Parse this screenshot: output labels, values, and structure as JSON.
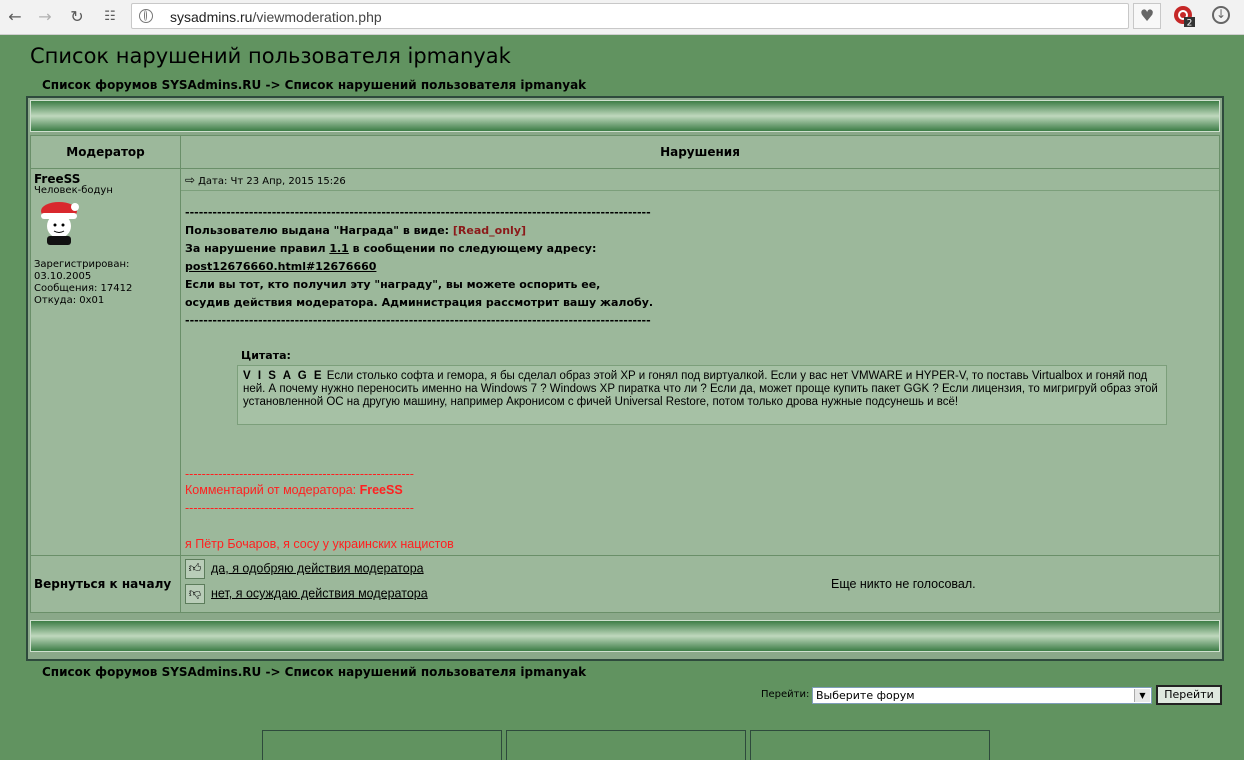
{
  "browser": {
    "url_host": "sysadmins.ru",
    "url_path": "/viewmoderation.php",
    "extension_badge": "2"
  },
  "page": {
    "title": "Список нарушений пользователя ipmanyak",
    "breadcrumb": {
      "root": "Список форумов SYSAdmins.RU",
      "sep": " -> ",
      "current": "Список нарушений пользователя ipmanyak"
    }
  },
  "table": {
    "col_moderator": "Модератор",
    "col_violations": "Нарушения"
  },
  "author": {
    "name": "FreeSS",
    "rank": "Человек-бодун",
    "registered_label": "Зарегистрирован:",
    "registered_date": "03.10.2005",
    "posts": "Сообщения: 17412",
    "from": "Откуда: 0x01"
  },
  "post": {
    "date": "Дата: Чт 23 Апр, 2015 15:26",
    "separator": "------------------------------------------------------------------------------------------------------",
    "award_prefix": "Пользователю выдана \"Награда\" в виде: ",
    "award_value": "[Read_only]",
    "rule_prefix": "За нарушение правил ",
    "rule_num": "1.1",
    "rule_suffix": " в сообщении по следующему адресу:",
    "link": "post12676660.html#12676660",
    "appeal_line1": "Если вы тот, кто получил эту \"награду\", вы можете оспорить ее,",
    "appeal_line2": "осудив действия модератора. Администрация рассмотрит вашу жалобу.",
    "quote_label": "Цитата:",
    "quote_author": "V I S A G E",
    "quote_text": "Если столько софта и гемора, я бы сделал образ этой XP и гонял под виртуалкой. Если у вас нет VMWARE и HYPER-V, то поставь Virtualbox и гоняй под ней. А почему нужно переносить именно на Windows 7 ? Windows XP пиратка что ли ? Если да, может проще купить пакет GGK ? Если лицензия, то мигригруй образ этой установленной ОС на другую машину, например Акронисом с фичей Universal Restore, потом только дрова нужные подсунешь и всё!",
    "red_separator": "-------------------------------------------------------",
    "comment_prefix": "Комментарий от модератора: ",
    "comment_author": "FreeSS",
    "comment_text": "я Пётр Бочаров, я сосу у украинских нацистов"
  },
  "footer_row": {
    "back_to_top": "Вернуться к началу",
    "vote_yes": "да, я одобряю действия модератора",
    "vote_no": "нет, я осуждаю действия модератора",
    "no_votes": "Еще никто не голосовал."
  },
  "jump": {
    "label": "Перейти:",
    "selected": "Выберите форум",
    "button": "Перейти"
  }
}
